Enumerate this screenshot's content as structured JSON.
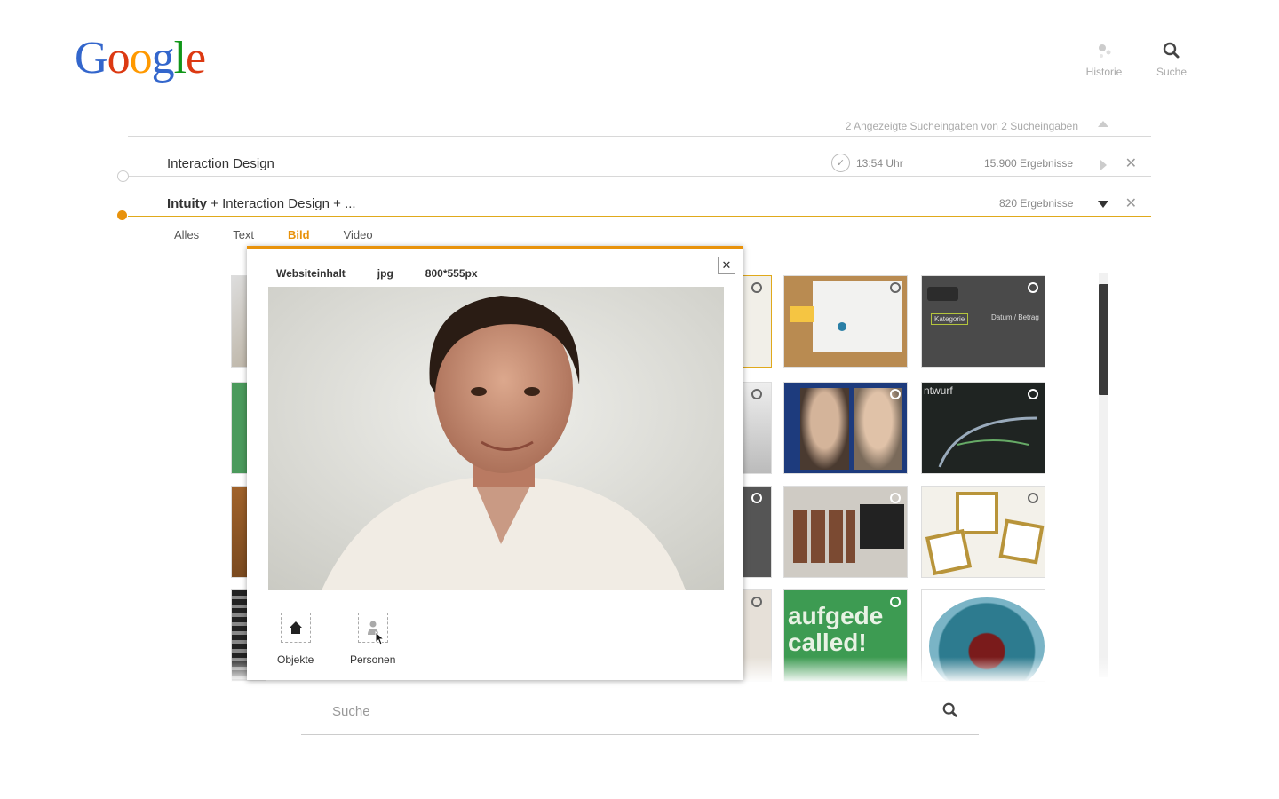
{
  "logo": {
    "text": "Google",
    "colors": [
      "#3366cc",
      "#dc3912",
      "#ff9900",
      "#3366cc",
      "#109618",
      "#dc3912"
    ]
  },
  "topnav": {
    "history_label": "Historie",
    "search_label": "Suche"
  },
  "history": {
    "summary": "2 Angezeigte  Sucheingaben von 2 Sucheingaben",
    "rows": [
      {
        "query": "Interaction Design",
        "time": "13:54 Uhr",
        "results": "15.900 Ergebnisse"
      },
      {
        "query_bold": "Intuity",
        "query_rest": " + Interaction Design + ...",
        "results": "820 Ergebnisse"
      }
    ]
  },
  "tabs": [
    {
      "label": "Alles"
    },
    {
      "label": "Text"
    },
    {
      "label": "Bild",
      "active": true
    },
    {
      "label": "Video"
    }
  ],
  "popup": {
    "type_label": "Websiteinhalt",
    "format_label": "jpg",
    "size_label": "800*555px",
    "close_label": "✕",
    "actions": [
      {
        "label": "Objekte",
        "icon": "house-icon"
      },
      {
        "label": "Personen",
        "icon": "person-icon"
      }
    ]
  },
  "thumbnails": {
    "right_columns": [
      {
        "caption": ""
      },
      {
        "caption": ""
      },
      {
        "caption": "ntwurf"
      },
      {
        "caption": ""
      },
      {
        "caption": ""
      },
      {
        "caption": "aufgede called!"
      }
    ],
    "kategorie_label": "Kategorie",
    "datum_label": "Datum / Betrag"
  },
  "bottom_search": {
    "placeholder": "Suche"
  },
  "colors": {
    "accent": "#e8920b",
    "rule": "#e0a91b"
  }
}
